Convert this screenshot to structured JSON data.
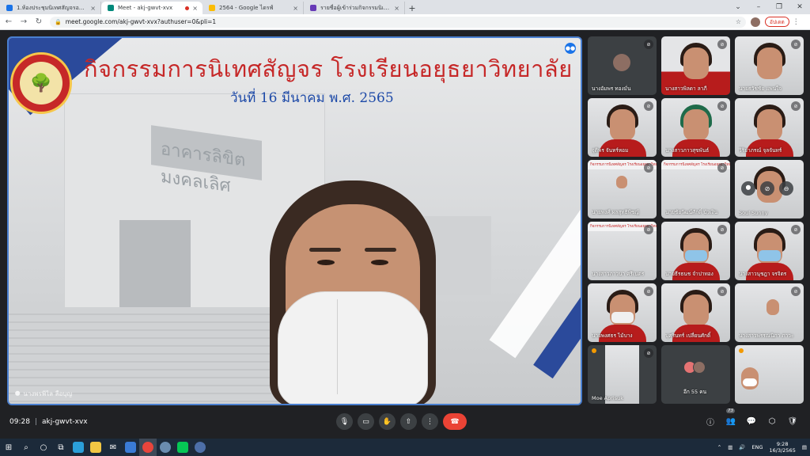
{
  "browser": {
    "tabs": [
      {
        "title": "1.ห้องประชุมนิเทศสัญจรออนไลน์ (กศ.",
        "favicon_color": "#1a73e8",
        "active": false
      },
      {
        "title": "Meet - akj-gwvt-xvx",
        "favicon_color": "#00897b",
        "active": true
      },
      {
        "title": "2564 - Google ไดรฟ์",
        "favicon_color": "#fbbc04",
        "active": false
      },
      {
        "title": "รายชื่อผู้เข้าร่วมกิจกรรมนิเทศสัญจรออน",
        "favicon_color": "#673ab7",
        "active": false
      }
    ],
    "new_tab": "+",
    "url": "meet.google.com/akj-gwvt-xvx?authuser=0&pli=1",
    "update_button": "อัปเดต"
  },
  "main_video": {
    "title": "กิจกรรมการนิเทศสัญจร  โรงเรียนอยุธยาวิทยาลัย",
    "date": "วันที่ 16 มีนาคม พ.ศ. 2565",
    "sign_text": "อาคารลิขิตมงคลเลิศ",
    "participant_name": "นางพรพิไล ลือบุญ",
    "logo_text": "AYUTTHAYA WITTAYALAI SCHOOL"
  },
  "participants": [
    {
      "name": "นางอัมพร ทองมั่น",
      "type": "avatar"
    },
    {
      "name": "นางสาวพิลดา ลาภี",
      "type": "video"
    },
    {
      "name": "นายธวัชชัย แพนใจ",
      "type": "video"
    },
    {
      "name": "จุติพร จันทร์หอม",
      "type": "video"
    },
    {
      "name": "นางสาวภาวสุขพันธ์",
      "type": "video"
    },
    {
      "name": "วิริยาภรณ์ จุลจันทร์",
      "type": "video"
    },
    {
      "name": "นายพงศ์ ผลสุทธิพิชญ์",
      "type": "banner"
    },
    {
      "name": "นายชัยวัฒน์ศักดิ์ บัวเงิน",
      "type": "banner"
    },
    {
      "name": "Soul Sunny",
      "type": "hover"
    },
    {
      "name": "นางสาวภาวนา ศรีเนตร",
      "type": "banner"
    },
    {
      "name": "นายธีรธนช จำปาทอง",
      "type": "video"
    },
    {
      "name": "นางสาวนุชฎา จรจิตร",
      "type": "video"
    },
    {
      "name": "นายพงศธร ไม้บาง",
      "type": "video"
    },
    {
      "name": "นุศรินทร์ เปลี่ยนศักดิ์",
      "type": "video"
    },
    {
      "name": "นางสาวพรรณนิภา ภาวะ",
      "type": "video"
    },
    {
      "name": "Moe Aprisuk",
      "type": "video"
    },
    {
      "name": "อีก 55 คน",
      "type": "more"
    },
    {
      "name": "",
      "type": "video"
    }
  ],
  "controls": {
    "time": "09:28",
    "separator": "|",
    "meeting_code": "akj-gwvt-xvx",
    "people_count": "73"
  },
  "taskbar": {
    "language": "ENG",
    "clock_time": "9:28",
    "clock_date": "16/3/2565"
  },
  "colors": {
    "title_red": "#c62828",
    "date_blue": "#1e4aa8",
    "end_call": "#ea4335",
    "active_speaker_border": "#4a7fcf"
  }
}
